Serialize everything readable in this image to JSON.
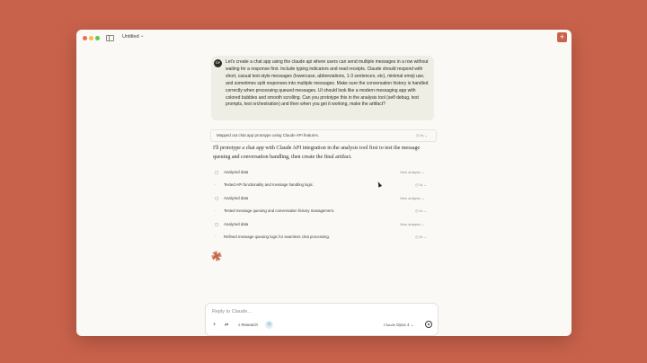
{
  "window": {
    "title": "Untitled"
  },
  "user_message": {
    "avatar_initials": "CY",
    "text": "Let's create a chat app using the claude api where users can send multiple messages in a row without waiting for a response first. Include typing indicators and read receipts. Claude should respond with short, casual text-style messages (lowercase, abbreviations, 1-3 sentences, etc), minimal emoji use, and sometimes split responses into multiple messages. Make sure the conversation history is handled correctly when processing queued messages. UI should look like a modern messaging app with colored bubbles and smooth scrolling. Can you prototype this in the analysis tool (self debug, test prompts, test orchestration) and then when you get it working, make the artifact?"
  },
  "thinking": {
    "summary": "Mapped out chat app prototype using Claude API features.",
    "duration": "3s"
  },
  "assistant_reply": "I'll prototype a chat app with Claude API integration in the analysis tool first to test the message queuing and conversation handling, then create the final artifact.",
  "steps": [
    {
      "kind": "analysis",
      "label": "Analyzed data",
      "meta": "View analysis"
    },
    {
      "kind": "thought",
      "label": "Tested API functionality and message handling logic.",
      "meta": "1s"
    },
    {
      "kind": "analysis",
      "label": "Analyzed data",
      "meta": "View analysis"
    },
    {
      "kind": "thought",
      "label": "Tested message queuing and conversation history management.",
      "meta": "1s"
    },
    {
      "kind": "analysis",
      "label": "Analyzed data",
      "meta": "View analysis"
    },
    {
      "kind": "thought",
      "label": "Refined message queuing logic for seamless chat processing.",
      "meta": "2s"
    }
  ],
  "composer": {
    "placeholder": "Reply to Claude...",
    "research_label": "Research",
    "model_name": "Claude",
    "model_version": "Opus 4"
  },
  "colors": {
    "background": "#c9624b",
    "accent": "#c9624b",
    "window": "#faf9f5",
    "user_bubble": "#efeee5"
  }
}
